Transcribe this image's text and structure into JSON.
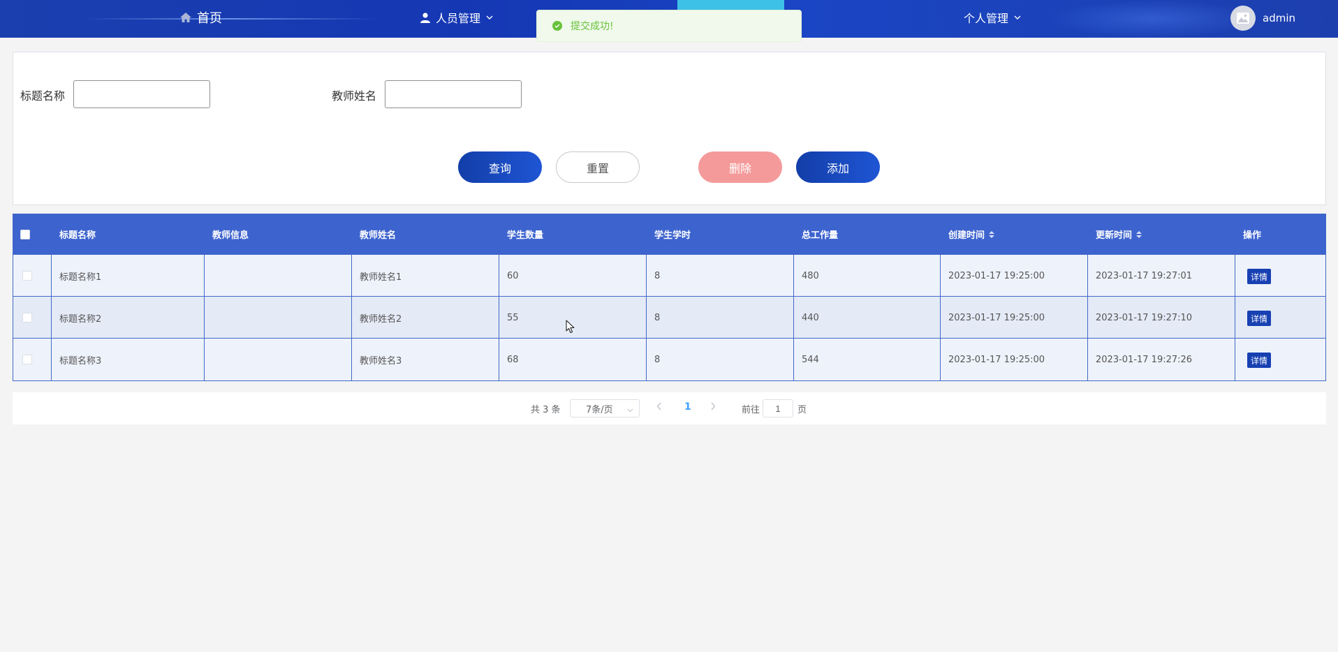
{
  "nav": {
    "home": "首页",
    "people": "人员管理",
    "personal": "个人管理",
    "username": "admin"
  },
  "toast": {
    "message": "提交成功!"
  },
  "search": {
    "title_label": "标题名称",
    "title_value": "",
    "teacher_label": "教师姓名",
    "teacher_value": ""
  },
  "buttons": {
    "query": "查询",
    "reset": "重置",
    "delete": "删除",
    "add": "添加"
  },
  "table": {
    "headers": [
      "标题名称",
      "教师信息",
      "教师姓名",
      "学生数量",
      "学生学时",
      "总工作量",
      "创建时间",
      "更新时间",
      "操作"
    ],
    "rows": [
      {
        "title": "标题名称1",
        "teacher_info": "",
        "teacher_name": "教师姓名1",
        "students": "60",
        "hours": "8",
        "workload": "480",
        "created": "2023-01-17 19:25:00",
        "updated": "2023-01-17 19:27:01",
        "action": "详情"
      },
      {
        "title": "标题名称2",
        "teacher_info": "",
        "teacher_name": "教师姓名2",
        "students": "55",
        "hours": "8",
        "workload": "440",
        "created": "2023-01-17 19:25:00",
        "updated": "2023-01-17 19:27:10",
        "action": "详情"
      },
      {
        "title": "标题名称3",
        "teacher_info": "",
        "teacher_name": "教师姓名3",
        "students": "68",
        "hours": "8",
        "workload": "544",
        "created": "2023-01-17 19:25:00",
        "updated": "2023-01-17 19:27:26",
        "action": "详情"
      }
    ]
  },
  "pagination": {
    "total": "共 3 条",
    "page_size": "7条/页",
    "current_page": "1",
    "goto_label": "前往",
    "goto_value": "1",
    "page_suffix": "页"
  },
  "colors": {
    "nav_bg": "#1537b4",
    "header_bg": "#3d63cf",
    "primary_button": "#1f55d4",
    "delete_button": "#f49a9a",
    "success": "#67c23a"
  }
}
